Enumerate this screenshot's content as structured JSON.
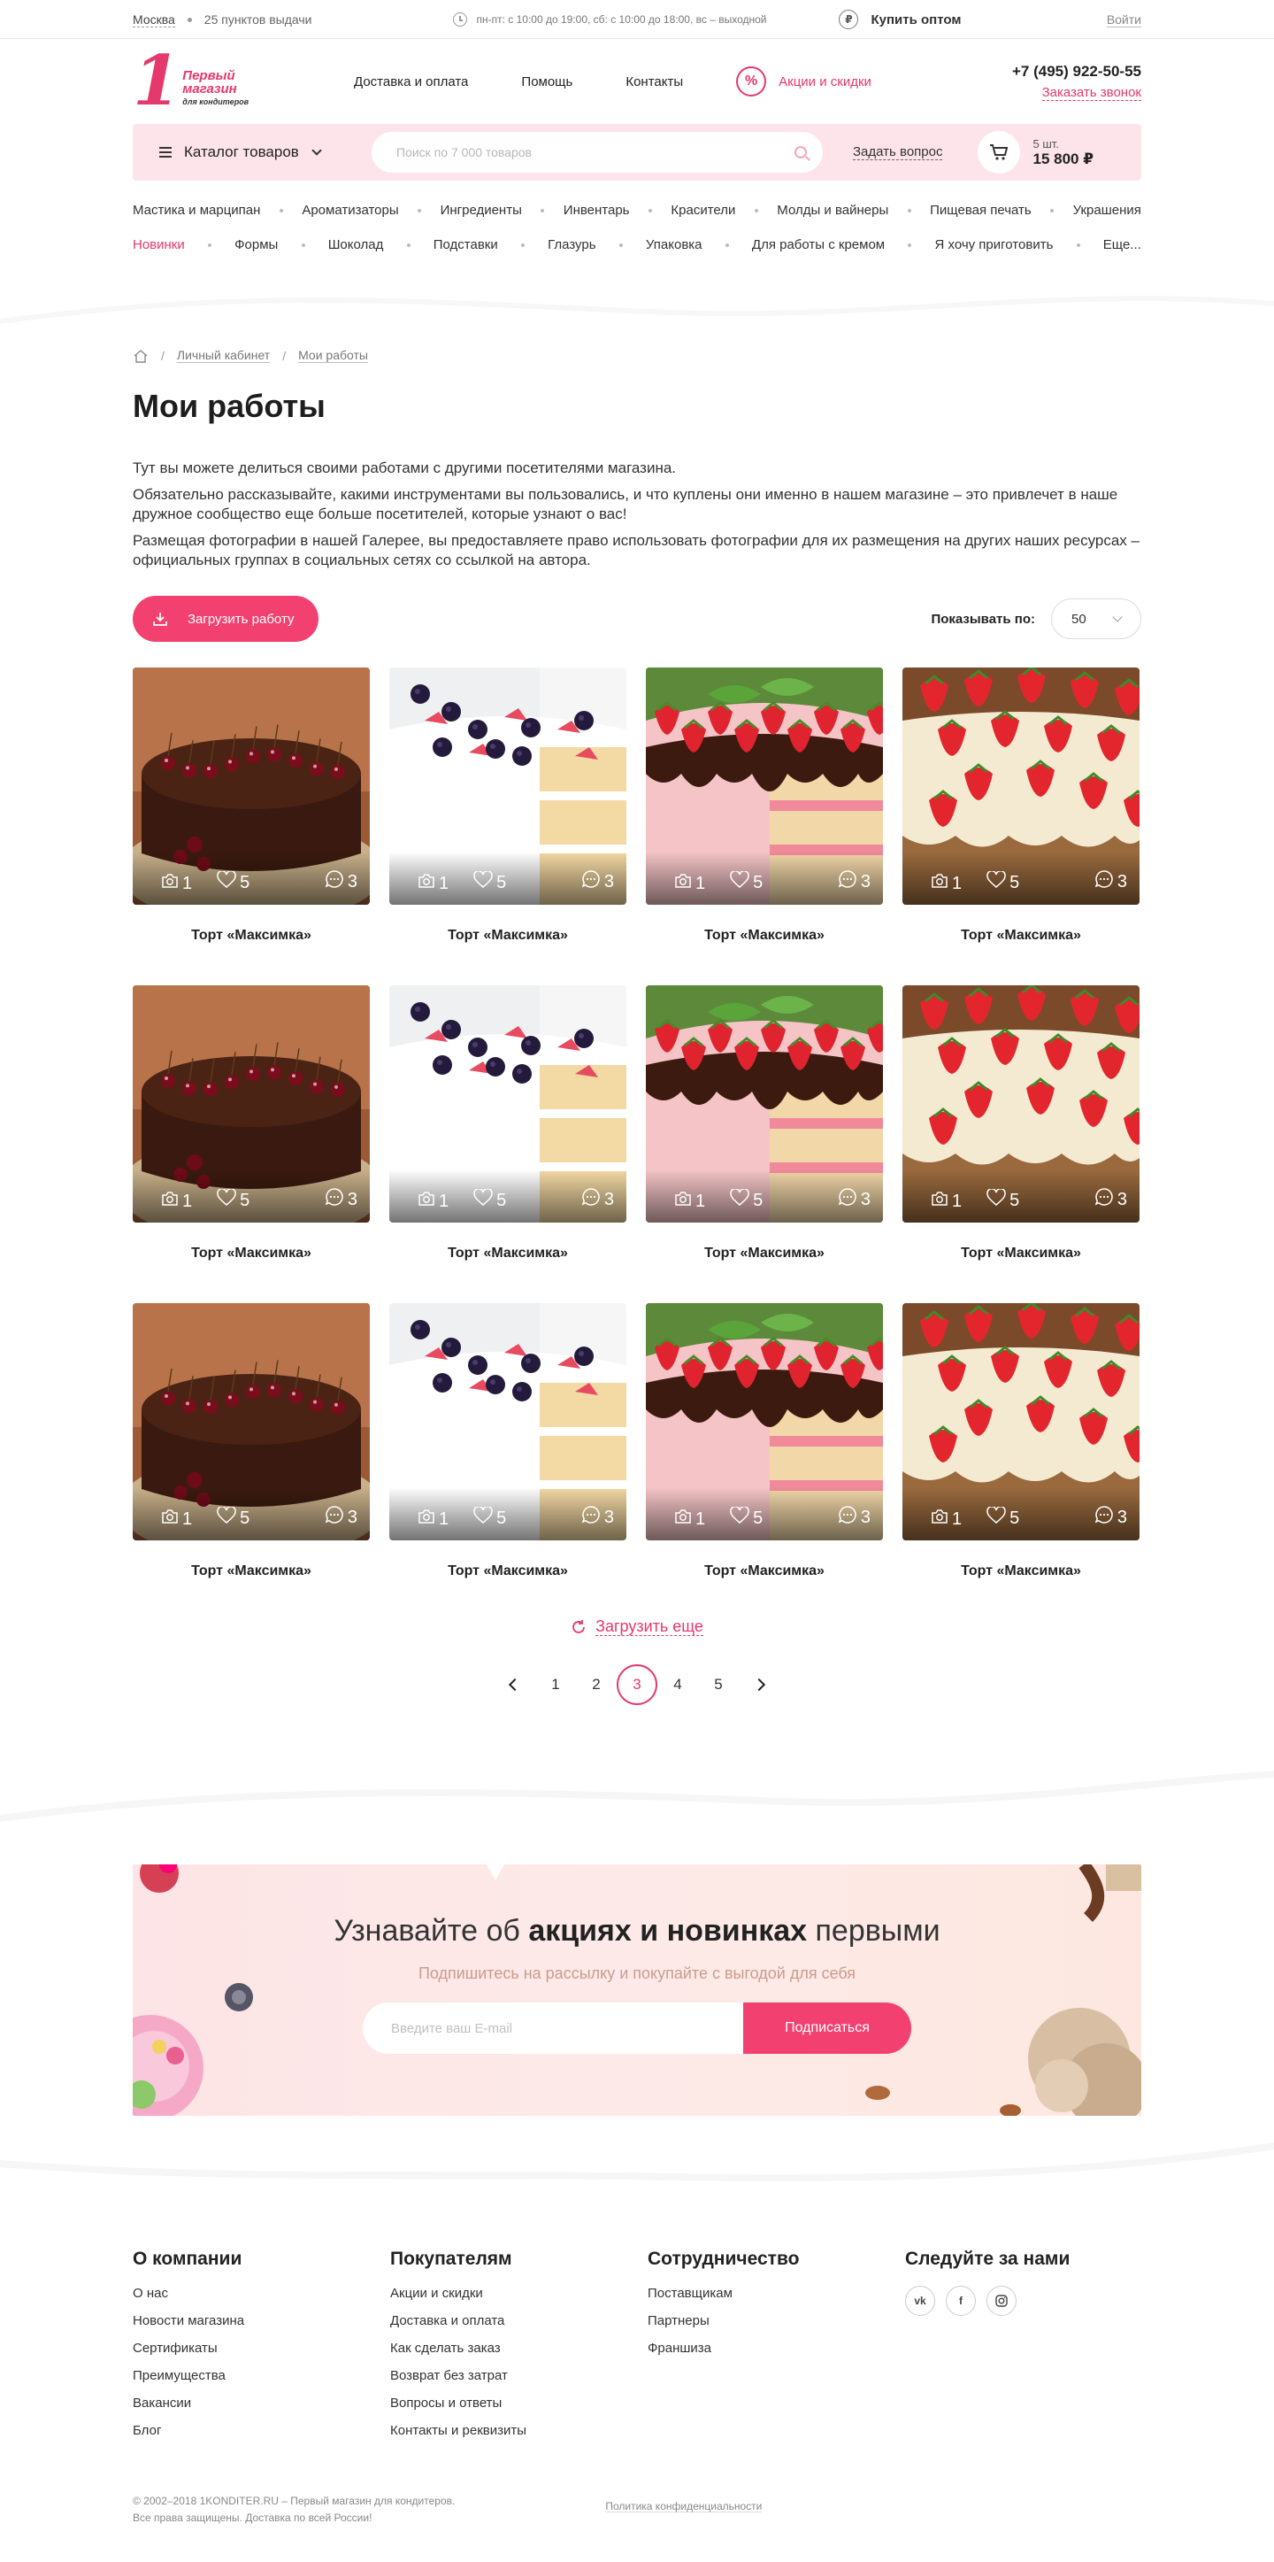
{
  "topbar": {
    "city": "Москва",
    "pickup": "25 пунктов выдачи",
    "hours": "пн-пт: с 10:00 до 19:00, сб: с 10:00 до 18:00, вс – выходной",
    "wholesale": "Купить оптом",
    "login": "Войти"
  },
  "header": {
    "logo_number": "1",
    "logo_line1": "Первый",
    "logo_line2": "магазин",
    "logo_line3": "для кондитеров",
    "nav": [
      "Доставка и оплата",
      "Помощь",
      "Контакты"
    ],
    "promo": "Акции и скидки",
    "promo_icon": "%",
    "phone": "+7 (495) 922-50-55",
    "callback": "Заказать звонок"
  },
  "bar": {
    "catalog": "Каталог товаров",
    "search_placeholder": "Поиск по 7 000 товаров",
    "ask": "Задать вопрос",
    "cart_count": "5 шт.",
    "cart_sum": "15 800 ₽"
  },
  "categories": {
    "row1": [
      "Мастика и марципан",
      "Ароматизаторы",
      "Ингредиенты",
      "Инвентарь",
      "Красители",
      "Молды и вайнеры",
      "Пищевая печать",
      "Украшения"
    ],
    "row2": [
      "Новинки",
      "Формы",
      "Шоколад",
      "Подставки",
      "Глазурь",
      "Упаковка",
      "Для работы с кремом",
      "Я хочу приготовить",
      "Еще..."
    ]
  },
  "breadcrumb": [
    "Личный кабинет",
    "Мои работы"
  ],
  "page": {
    "title": "Мои работы",
    "intro": [
      "Тут вы можете делиться своими работами с другими посетителями магазина.",
      "Обязательно рассказывайте, какими инструментами вы пользовались, и что куплены они именно в нашем магазине – это привлечет в наше дружное сообщество еще больше посетителей, которые узнают о вас!",
      "Размещая фотографии в нашей Галерее, вы предоставляете право использовать фотографии для их размещения на других наших ресурсах – официальных группах в социальных сетях со ссылкой на автора."
    ],
    "upload": "Загрузить работу",
    "per_page_label": "Показывать по:",
    "per_page_value": "50"
  },
  "works": [
    {
      "title": "Торт «Максимка»",
      "photos": "1",
      "likes": "5",
      "comments": "3",
      "cake": "chocolate-cherry"
    },
    {
      "title": "Торт «Максимка»",
      "photos": "1",
      "likes": "5",
      "comments": "3",
      "cake": "berry-white"
    },
    {
      "title": "Торт «Максимка»",
      "photos": "1",
      "likes": "5",
      "comments": "3",
      "cake": "strawberry-drip"
    },
    {
      "title": "Торт «Максимка»",
      "photos": "1",
      "likes": "5",
      "comments": "3",
      "cake": "strawberry-cream"
    },
    {
      "title": "Торт «Максимка»",
      "photos": "1",
      "likes": "5",
      "comments": "3",
      "cake": "chocolate-cherry"
    },
    {
      "title": "Торт «Максимка»",
      "photos": "1",
      "likes": "5",
      "comments": "3",
      "cake": "berry-white"
    },
    {
      "title": "Торт «Максимка»",
      "photos": "1",
      "likes": "5",
      "comments": "3",
      "cake": "strawberry-drip"
    },
    {
      "title": "Торт «Максимка»",
      "photos": "1",
      "likes": "5",
      "comments": "3",
      "cake": "strawberry-cream"
    },
    {
      "title": "Торт «Максимка»",
      "photos": "1",
      "likes": "5",
      "comments": "3",
      "cake": "chocolate-cherry"
    },
    {
      "title": "Торт «Максимка»",
      "photos": "1",
      "likes": "5",
      "comments": "3",
      "cake": "berry-white"
    },
    {
      "title": "Торт «Максимка»",
      "photos": "1",
      "likes": "5",
      "comments": "3",
      "cake": "strawberry-drip"
    },
    {
      "title": "Торт «Максимка»",
      "photos": "1",
      "likes": "5",
      "comments": "3",
      "cake": "strawberry-cream"
    }
  ],
  "load_more": "Загрузить еще",
  "pagination": {
    "pages": [
      "1",
      "2",
      "3",
      "4",
      "5"
    ],
    "current": "3"
  },
  "subscribe": {
    "title_pre": "Узнавайте об ",
    "title_bold": "акциях и новинках",
    "title_post": " первыми",
    "subtitle": "Подпишитесь на рассылку и покупайте с выгодой для себя",
    "placeholder": "Введите ваш E-mail",
    "button": "Подписаться"
  },
  "footer": {
    "cols": [
      {
        "title": "О компании",
        "links": [
          "О нас",
          "Новости магазина",
          "Сертификаты",
          "Преимущества",
          "Вакансии",
          "Блог"
        ]
      },
      {
        "title": "Покупателям",
        "links": [
          "Акции и скидки",
          "Доставка и оплата",
          "Как сделать заказ",
          "Возврат без затрат",
          "Вопросы и ответы",
          "Контакты и реквизиты"
        ]
      },
      {
        "title": "Сотрудничество",
        "links": [
          "Поставщикам",
          "Партнеры",
          "Франшиза"
        ]
      }
    ],
    "social_title": "Следуйте за нами",
    "socials": [
      "vk",
      "f",
      "ig"
    ],
    "copyright1": "© 2002–2018 1KONDITER.RU – Первый магазин для кондитеров.",
    "copyright2": "Все права защищены. Доставка по всей России!",
    "privacy": "Политика конфиденциальности"
  },
  "colors": {
    "accent": "#e5386b",
    "button": "#f24170",
    "pink_bg": "#fde4ea"
  }
}
